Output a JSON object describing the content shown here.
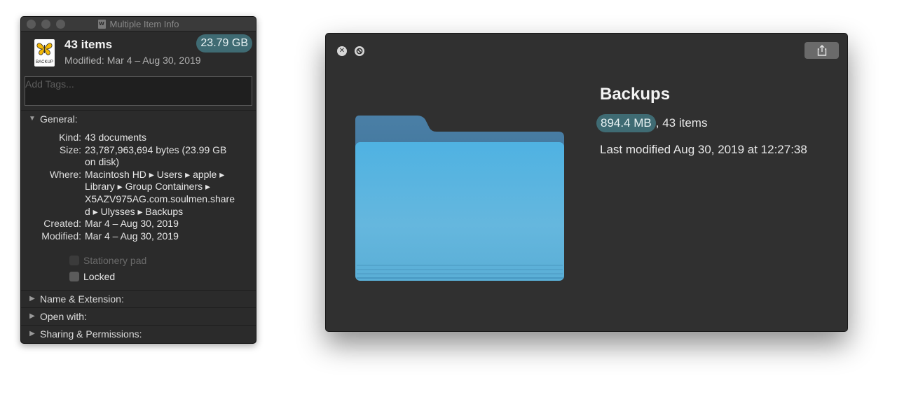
{
  "info_window": {
    "title": "Multiple Item Info",
    "doc_icon_glyph": "W",
    "summary": {
      "name": "43 items",
      "modified": "Modified: Mar 4 – Aug 30, 2019",
      "size": "23.79 GB",
      "icon_label": "BACKUP"
    },
    "tags_placeholder": "Add Tags...",
    "general": {
      "header": "General:",
      "rows": [
        {
          "key": "Kind:",
          "value": [
            "43 documents"
          ]
        },
        {
          "key": "Size:",
          "value": [
            "23,787,963,694 bytes (23.99 GB",
            "on disk)"
          ]
        },
        {
          "key": "Where:",
          "value": [
            "Macintosh HD ▸ Users ▸ apple ▸",
            "Library ▸ Group Containers ▸",
            "X5AZV975AG.com.soulmen.share",
            "d ▸ Ulysses ▸ Backups"
          ]
        },
        {
          "key": "Created:",
          "value": [
            "Mar 4 – Aug 30, 2019"
          ]
        },
        {
          "key": "Modified:",
          "value": [
            "Mar 4 – Aug 30, 2019"
          ]
        }
      ],
      "stationery_label": "Stationery pad",
      "locked_label": "Locked"
    },
    "sections": [
      {
        "label": "Name & Extension:"
      },
      {
        "label": "Open with:"
      },
      {
        "label": "Sharing & Permissions:"
      }
    ]
  },
  "quicklook": {
    "title": "Backups",
    "size": "894.4 MB",
    "items": ", 43 items",
    "modified": "Last modified Aug 30, 2019 at 12:27:38",
    "close_icon": "close-icon",
    "stop_icon": "stop-icon",
    "share_icon": "share-icon"
  },
  "colors": {
    "badge": "#3f6b73",
    "folder_front": "#5ab3de",
    "folder_back": "#3e7ea8"
  }
}
